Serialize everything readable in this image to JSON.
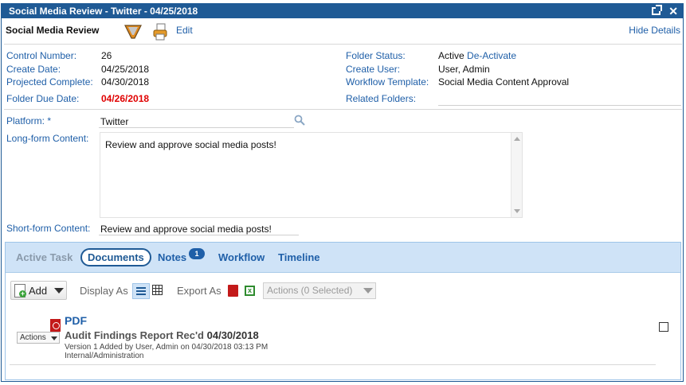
{
  "window": {
    "title": "Social Media Review - Twitter - 04/25/2018"
  },
  "toolbar": {
    "title": "Social Media Review",
    "edit_label": "Edit",
    "hide_details_label": "Hide Details"
  },
  "details": {
    "control_number_label": "Control Number:",
    "control_number": "26",
    "create_date_label": "Create Date:",
    "create_date": "04/25/2018",
    "projected_complete_label": "Projected Complete:",
    "projected_complete": "04/30/2018",
    "folder_due_date_label": "Folder Due Date:",
    "folder_due_date": "04/26/2018",
    "folder_status_label": "Folder Status:",
    "folder_status": "Active",
    "deactivate_label": "De-Activate",
    "create_user_label": "Create User:",
    "create_user": "User, Admin",
    "workflow_template_label": "Workflow Template:",
    "workflow_template": "Social Media Content Approval",
    "related_folders_label": "Related Folders:"
  },
  "fields": {
    "platform_label": "Platform: *",
    "platform_value": "Twitter",
    "long_form_label": "Long-form Content:",
    "long_form_value": "Review and approve social media posts!",
    "short_form_label": "Short-form Content:",
    "short_form_value": "Review and approve social media posts!"
  },
  "tabs": {
    "active_task": "Active Task",
    "documents": "Documents",
    "notes": "Notes",
    "notes_count": "1",
    "workflow": "Workflow",
    "timeline": "Timeline"
  },
  "documents_toolbar": {
    "add_label": "Add",
    "display_as_label": "Display As",
    "export_as_label": "Export As",
    "actions_label": "Actions (0 Selected)"
  },
  "document_row": {
    "actions_label": "Actions",
    "type_label": "PDF",
    "title": "Audit Findings Report",
    "received_prefix": "Rec'd",
    "received_date": "04/30/2018",
    "version_line": "Version 1 Added by User, Admin on 04/30/2018 03:13 PM",
    "category": "Internal/Administration"
  },
  "colors": {
    "brand": "#1f5a95",
    "link": "#1f5fa8",
    "due_date": "#e00000",
    "tab_bar": "#cfe3f7"
  }
}
